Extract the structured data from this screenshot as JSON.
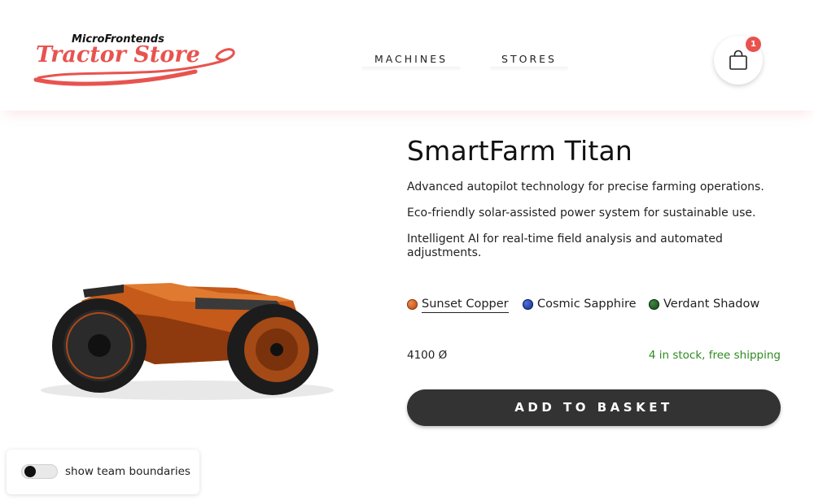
{
  "header": {
    "logo": {
      "top_text": "MicroFrontends",
      "main_text": "Tractor Store",
      "color": "#e8534f"
    },
    "nav": [
      {
        "label": "MACHINES"
      },
      {
        "label": "STORES"
      }
    ],
    "basket": {
      "icon": "shopping-bag-icon",
      "count": "1",
      "badge_color": "#e8534f"
    }
  },
  "product": {
    "image": "orange tractor illustration",
    "title": "SmartFarm Titan",
    "features": [
      "Advanced autopilot technology for precise farming operations.",
      "Eco-friendly solar-assisted power system for sustainable use.",
      "Intelligent AI for real-time field analysis and automated adjustments."
    ],
    "variants": [
      {
        "label": "Sunset Copper",
        "color": "#c8541e",
        "selected": true
      },
      {
        "label": "Cosmic Sapphire",
        "color": "#1f3fa0",
        "selected": false
      },
      {
        "label": "Verdant Shadow",
        "color": "#1f5b23",
        "selected": false
      }
    ],
    "price": "4100 Ø",
    "stock": "4 in stock, free shipping",
    "stock_color": "#2e8a1f",
    "add_to_basket": "ADD TO BASKET"
  },
  "toggle": {
    "label": "show team boundaries",
    "on": false
  }
}
